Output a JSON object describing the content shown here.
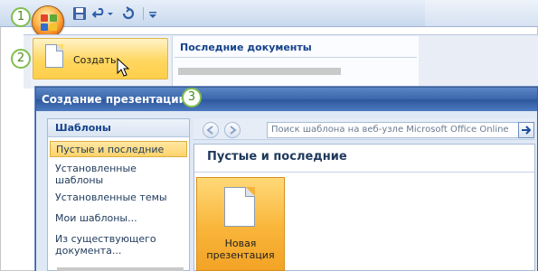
{
  "markers": [
    "1",
    "2",
    "3"
  ],
  "office_menu": {
    "create_label": "Создать",
    "recent_title": "Последние документы"
  },
  "dialog": {
    "title": "Создание презентации",
    "sidebar": {
      "header": "Шаблоны",
      "items": [
        "Пустые и последние",
        "Установленные шаблоны",
        "Установленные темы",
        "Мои шаблоны...",
        "Из существующего документа..."
      ]
    },
    "search": {
      "placeholder": "Поиск шаблона на веб-узле Microsoft Office Online"
    },
    "content": {
      "section_title": "Пустые и последние",
      "tile_label": "Новая презентация"
    }
  },
  "colors": {
    "title_bar": "#3a66ab",
    "selection": "#ffd36a",
    "marker_green": "#7fbf4d"
  }
}
